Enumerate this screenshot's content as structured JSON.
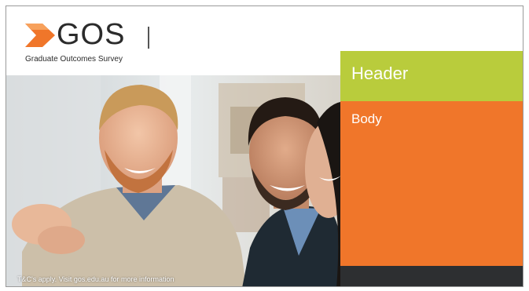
{
  "brand": {
    "logo_text": "GOS",
    "tagline": "Graduate Outcomes Survey",
    "accent_color": "#f0762a",
    "logo_mark_icon": "chevron-arrow-icon"
  },
  "panel": {
    "header_text": "Header",
    "body_text": "Body",
    "header_color": "#b9cc3c",
    "body_color": "#f0762a"
  },
  "photo": {
    "disclaimer": "T&C's apply. Visit gos.edu.au for more information"
  }
}
